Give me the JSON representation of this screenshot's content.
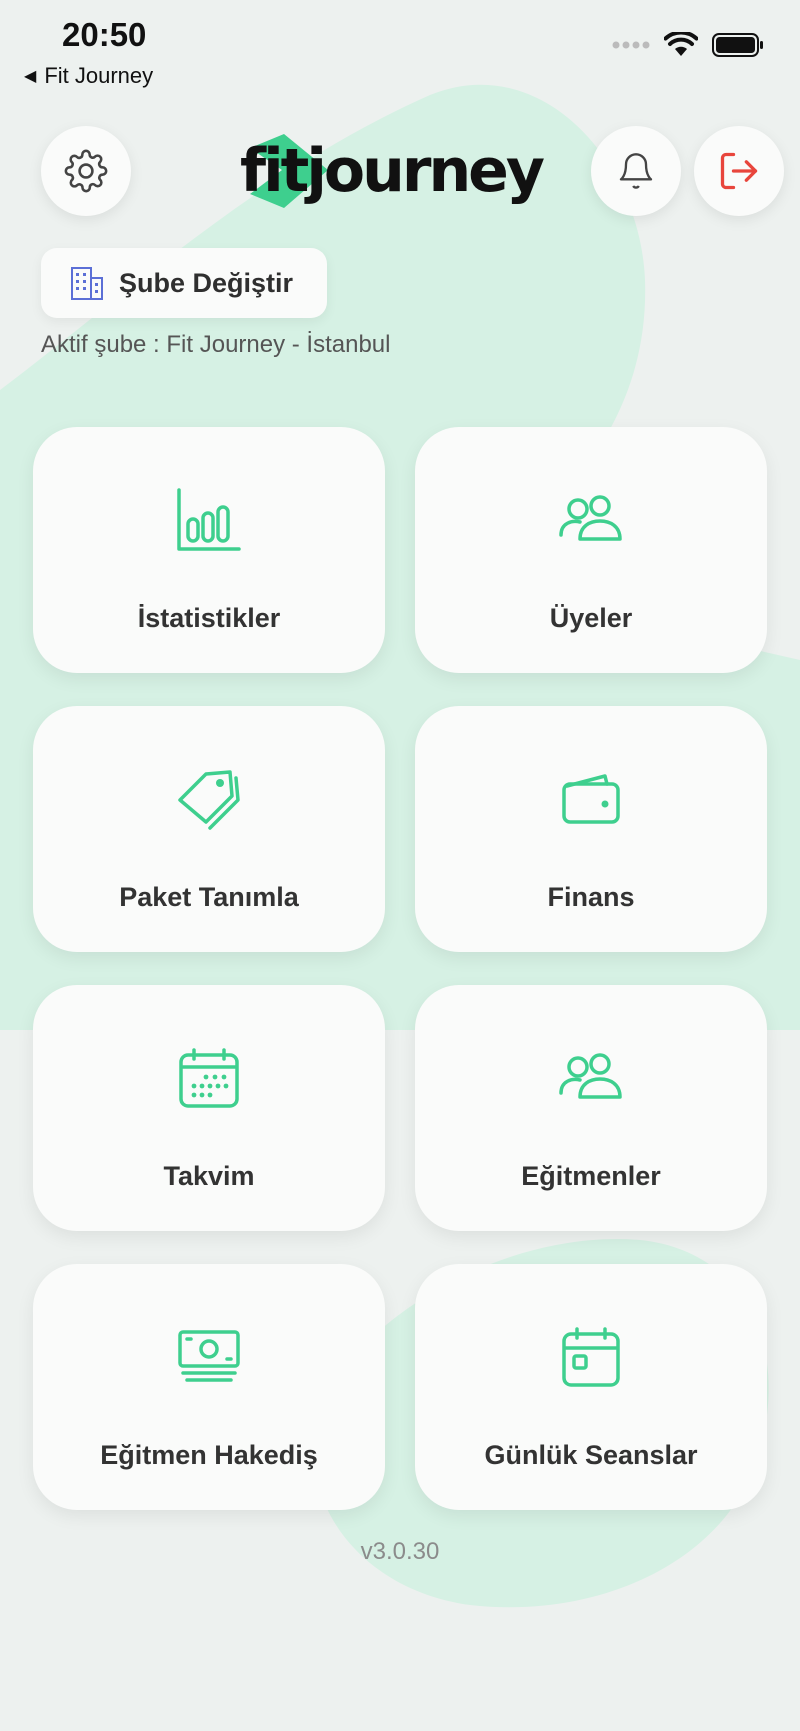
{
  "status_bar": {
    "time": "20:50",
    "back_label": "Fit Journey"
  },
  "header": {
    "logo_text": "fitjourney",
    "settings_icon": "gear-icon",
    "notifications_icon": "bell-icon",
    "logout_icon": "logout-icon"
  },
  "branch": {
    "change_label": "Şube Değiştir",
    "active_text": "Aktif şube : Fit Journey - İstanbul"
  },
  "menu": [
    {
      "label": "İstatistikler",
      "icon": "bar-chart-icon"
    },
    {
      "label": "Üyeler",
      "icon": "users-icon"
    },
    {
      "label": "Paket Tanımla",
      "icon": "tag-icon"
    },
    {
      "label": "Finans",
      "icon": "wallet-icon"
    },
    {
      "label": "Takvim",
      "icon": "calendar-icon"
    },
    {
      "label": "Eğitmenler",
      "icon": "users-icon"
    },
    {
      "label": "Eğitmen Hakediş",
      "icon": "cash-icon"
    },
    {
      "label": "Günlük Seanslar",
      "icon": "calendar-day-icon"
    }
  ],
  "version": "v3.0.30",
  "colors": {
    "accent": "#3ecf8e",
    "logout": "#e8453c",
    "background": "#edf1ef",
    "card": "#fafbfa"
  }
}
